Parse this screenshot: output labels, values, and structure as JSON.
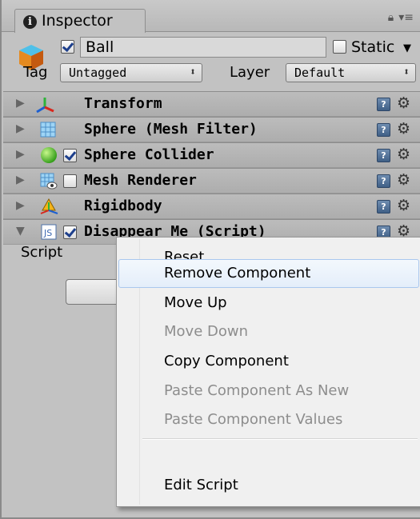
{
  "tab": {
    "title": "Inspector",
    "info_icon": "i"
  },
  "object": {
    "name": "Ball",
    "active": true,
    "static_label": "Static",
    "static_checked": false,
    "tag_label": "Tag",
    "tag_value": "Untagged",
    "layer_label": "Layer",
    "layer_value": "Default"
  },
  "components": [
    {
      "title": "Transform",
      "icon": "transform-icon",
      "has_checkbox": false
    },
    {
      "title": "Sphere (Mesh Filter)",
      "icon": "mesh-filter-icon",
      "has_checkbox": false
    },
    {
      "title": "Sphere Collider",
      "icon": "sphere-collider-icon",
      "has_checkbox": true,
      "checked": true
    },
    {
      "title": "Mesh Renderer",
      "icon": "mesh-renderer-icon",
      "has_checkbox": true,
      "checked": false
    },
    {
      "title": "Rigidbody",
      "icon": "rigidbody-icon",
      "has_checkbox": false
    },
    {
      "title": "Disappear Me (Script)",
      "icon": "js-script-icon",
      "has_checkbox": true,
      "checked": true
    }
  ],
  "script_field_label": "Script",
  "context_menu": {
    "items": [
      {
        "label": "Reset",
        "enabled": true
      },
      {
        "label": "Remove Component",
        "enabled": true,
        "highlighted": true
      },
      {
        "label": "Move Up",
        "enabled": true
      },
      {
        "label": "Move Down",
        "enabled": false
      },
      {
        "label": "Copy Component",
        "enabled": true
      },
      {
        "label": "Paste Component As New",
        "enabled": false
      },
      {
        "label": "Paste Component Values",
        "enabled": false
      },
      {
        "label": "Edit Script",
        "enabled": true
      }
    ]
  },
  "colors": {
    "panel_bg": "#c2c2c2",
    "menu_bg": "#f0f0f0",
    "menu_highlight_border": "#a9c7ee",
    "disabled_text": "#8d8d8d"
  }
}
